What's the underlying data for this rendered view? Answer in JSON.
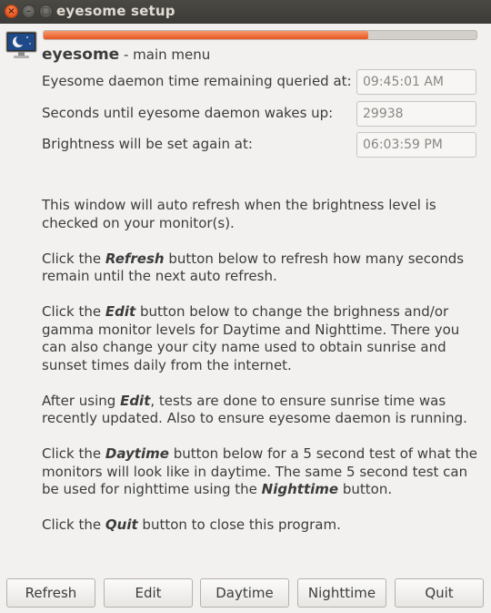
{
  "window": {
    "title": "eyesome setup",
    "close_glyph": "×",
    "min_glyph": "–",
    "max_glyph": "□"
  },
  "progress": {
    "value_percent": 75
  },
  "header": {
    "app_name": "eyesome",
    "subtitle": " - main menu",
    "icon": "monitor-moon-icon"
  },
  "status": {
    "rows": [
      {
        "label": "Eyesome daemon time remaining queried at:",
        "value": "09:45:01 AM"
      },
      {
        "label": "Seconds until eyesome daemon wakes up:",
        "value": "29938"
      },
      {
        "label": "Brightness will be set again at:",
        "value": "06:03:59 PM"
      }
    ]
  },
  "body": {
    "p1": "This window will auto refresh when the brightness level is checked on your monitor(s).",
    "p2_pre": "Click the ",
    "p2_em": "Refresh",
    "p2_post": " button below to refresh how many seconds remain until the next auto refresh.",
    "p3_pre": "Click the ",
    "p3_em": "Edit",
    "p3_post": " button below to change the brighness and/or gamma monitor levels for Daytime and Nighttime. There you can also change your city name used to obtain sunrise and sunset times daily from the internet.",
    "p4_pre": "After using ",
    "p4_em": "Edit",
    "p4_post": ", tests are done to ensure sunrise time was recently updated. Also to ensure eyesome daemon is running.",
    "p5_pre": "Click the ",
    "p5_em": "Daytime",
    "p5_mid": " button below for a 5 second test of what the monitors will look like in daytime. The same 5 second test can be used for nighttime using the ",
    "p5_em2": "Nighttime",
    "p5_post": " button.",
    "p6_pre": "Click the ",
    "p6_em": "Quit",
    "p6_post": " button to close this program."
  },
  "buttons": {
    "refresh": "Refresh",
    "edit": "Edit",
    "daytime": "Daytime",
    "nighttime": "Nighttime",
    "quit": "Quit"
  },
  "colors": {
    "titlebar": "#3c3b37",
    "accent": "#e95420",
    "window_bg": "#f2f1f0"
  }
}
